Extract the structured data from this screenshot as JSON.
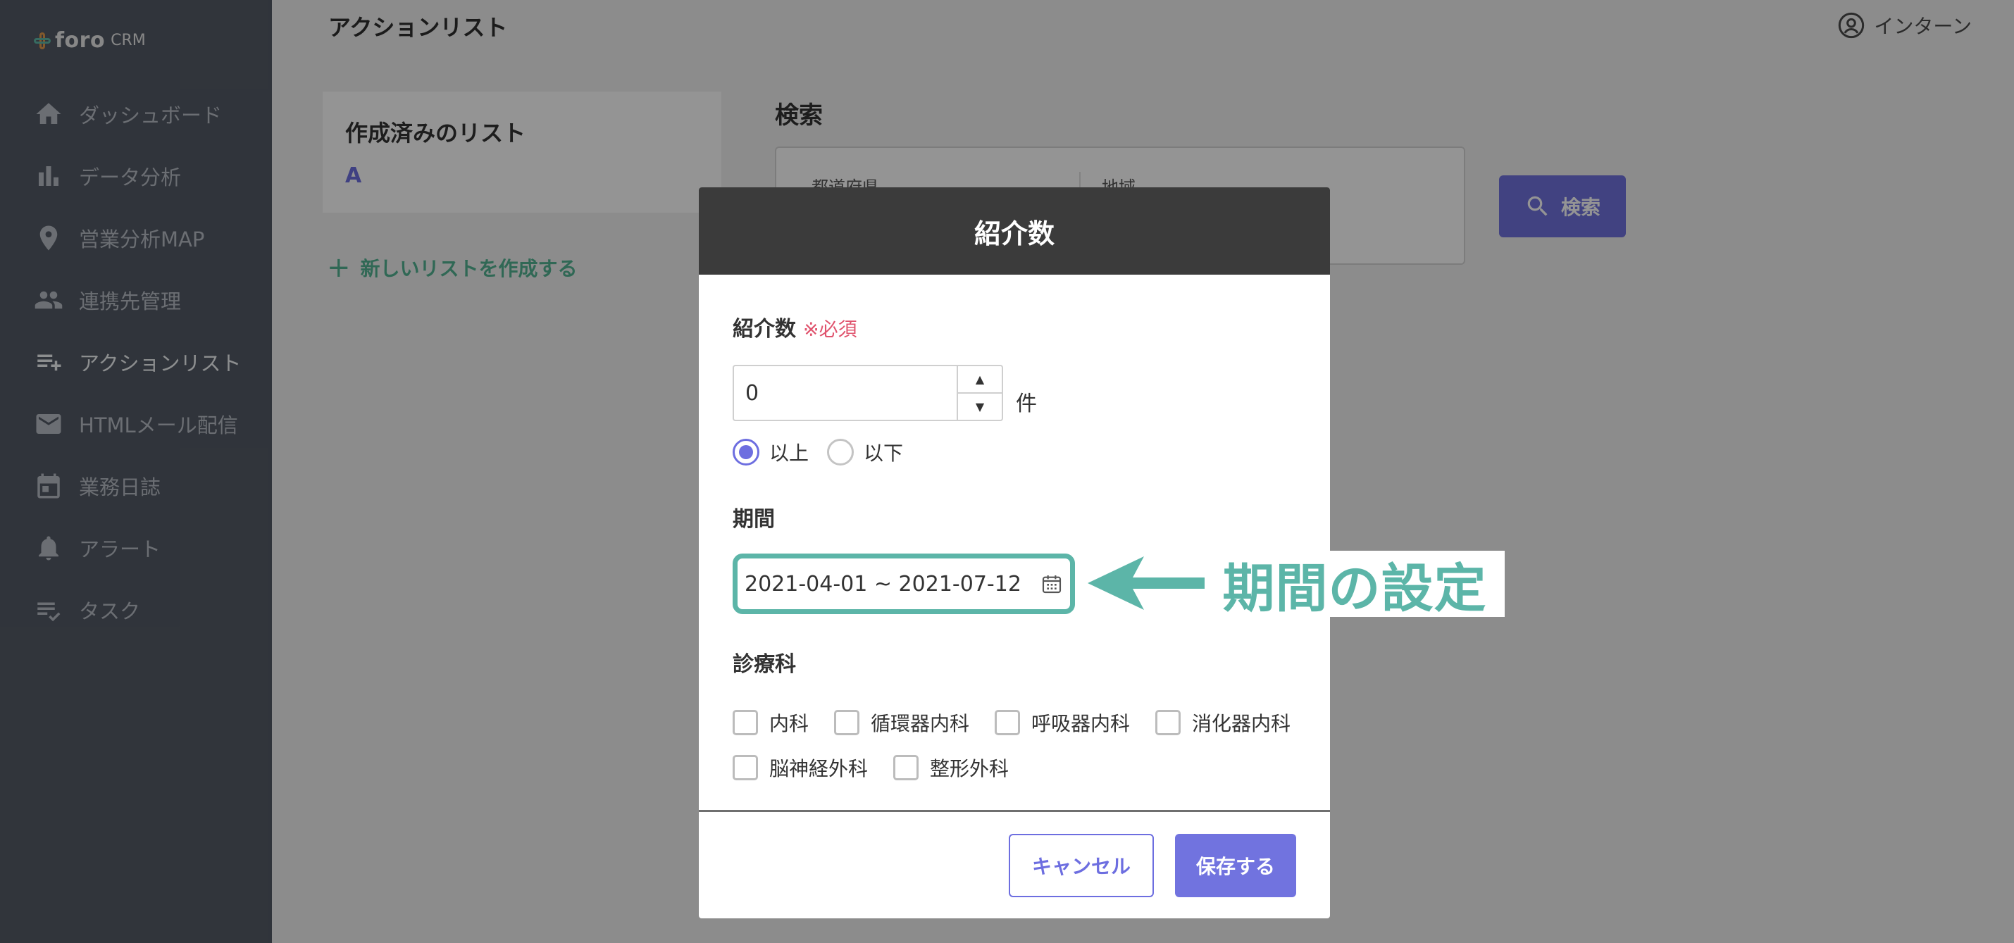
{
  "app": {
    "logo_name": "foro",
    "logo_sub": "CRM"
  },
  "sidebar": {
    "items": [
      {
        "label": "ダッシュボード",
        "icon": "home-icon"
      },
      {
        "label": "データ分析",
        "icon": "bar-chart-icon"
      },
      {
        "label": "営業分析MAP",
        "icon": "map-pin-icon"
      },
      {
        "label": "連携先管理",
        "icon": "people-icon"
      },
      {
        "label": "アクションリスト",
        "icon": "playlist-add-icon",
        "active": true
      },
      {
        "label": "HTMLメール配信",
        "icon": "mail-icon"
      },
      {
        "label": "業務日誌",
        "icon": "calendar-icon"
      },
      {
        "label": "アラート",
        "icon": "bell-icon"
      },
      {
        "label": "タスク",
        "icon": "checklist-icon"
      }
    ]
  },
  "header": {
    "title": "アクションリスト",
    "user_name": "インターン"
  },
  "lists_panel": {
    "title": "作成済みのリスト",
    "items": [
      "A"
    ],
    "new_list_label": "新しいリストを作成する"
  },
  "search": {
    "title": "検索",
    "fields": [
      "都道府県",
      "地域"
    ],
    "button_label": "検索"
  },
  "modal": {
    "title": "紹介数",
    "count_label": "紹介数",
    "required_label": "※必須",
    "count_value": "0",
    "unit": "件",
    "radio_options": [
      {
        "label": "以上",
        "checked": true
      },
      {
        "label": "以下",
        "checked": false
      }
    ],
    "period_label": "期間",
    "period_value": "2021-04-01 ~ 2021-07-12",
    "department_label": "診療科",
    "departments": [
      "内科",
      "循環器内科",
      "呼吸器内科",
      "消化器内科",
      "脳神経外科",
      "整形外科"
    ],
    "cancel_label": "キャンセル",
    "save_label": "保存する"
  },
  "annotation": {
    "label": "期間の設定",
    "color": "#5cb5a8"
  },
  "colors": {
    "accent": "#6d6ee0",
    "sidebar_bg": "#545b66",
    "success": "#54b493",
    "required": "#e0546e"
  }
}
